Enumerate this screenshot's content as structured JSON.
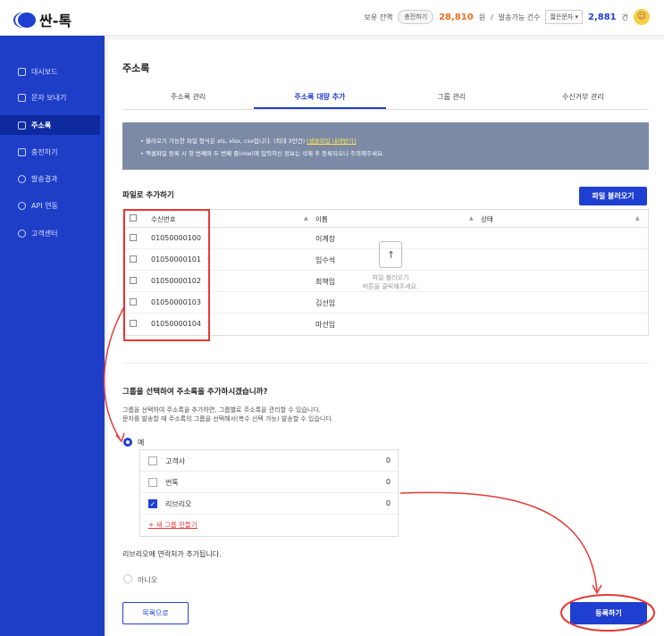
{
  "header": {
    "logo": "싼-톡",
    "balance_label": "보유 잔액",
    "charge_button": "충전하기",
    "balance_amount": "28,810",
    "balance_unit": "원",
    "sep": "/",
    "sendable_label": "발송가능 건수",
    "msg_type": "짧은문자",
    "sendable_count": "2,881",
    "sendable_unit": "건"
  },
  "sidebar": {
    "items": [
      {
        "label": "대시보드",
        "icon": "dashboard-icon"
      },
      {
        "label": "문자 보내기",
        "icon": "chat-icon"
      },
      {
        "label": "주소록",
        "icon": "people-icon"
      },
      {
        "label": "충전하기",
        "icon": "card-icon"
      },
      {
        "label": "발송결과",
        "icon": "target-icon"
      },
      {
        "label": "API 연동",
        "icon": "api-icon"
      },
      {
        "label": "고객센터",
        "icon": "help-icon"
      }
    ]
  },
  "page": {
    "title": "주소록"
  },
  "tabs": [
    {
      "label": "주소록 관리"
    },
    {
      "label": "주소록 대량 추가"
    },
    {
      "label": "그룹 관리"
    },
    {
      "label": "수신거부 관리"
    }
  ],
  "notice": {
    "line1": "불러오기 가능한 파일 형식은 xls, xlsx, csv입니다. (최대 3만건)",
    "line1_link": "[샘플파일 내려받기]",
    "line2": "엑셀파일 등록 시 첫 번째와 두 번째 줄(row)에 입력하신 정보는 삭제 후 등록되오니 주의해주세요."
  },
  "file_section": {
    "title": "파일로 추가하기",
    "load_button": "파일 불러오기"
  },
  "table": {
    "headers": [
      "수신번호",
      "이름",
      "상태"
    ],
    "rows": [
      {
        "number": "01050000100",
        "name": "이계장"
      },
      {
        "number": "01050000101",
        "name": "임수석"
      },
      {
        "number": "01050000102",
        "name": "최책임"
      },
      {
        "number": "01050000103",
        "name": "김선임"
      },
      {
        "number": "01050000104",
        "name": "마선임"
      }
    ],
    "upload_line1": "파일 불러오기",
    "upload_line2": "버튼을 클릭해주세요."
  },
  "group_section": {
    "title": "그룹을 선택하여 주소록을 추가하시겠습니까?",
    "desc1": "그룹을 선택하여 주소록을 추가하면, 그룹별로 주소록을 관리할 수 있습니다.",
    "desc2": "문자를 발송할 때 주소록의 그룹을 선택해서(복수 선택 가능) 발송할 수 있습니다.",
    "yes": "예",
    "no": "아니오",
    "groups": [
      {
        "label": "고객사",
        "count": "0",
        "checked": false
      },
      {
        "label": "썬톡",
        "count": "0",
        "checked": false
      },
      {
        "label": "리브리오",
        "count": "0",
        "checked": true
      }
    ],
    "new_group": "+ 새 그룹 만들기",
    "result": "리브리오에 연락처가 추가됩니다."
  },
  "buttons": {
    "back": "목록으로",
    "register": "등록하기"
  },
  "colors": {
    "brand": "#1f3fd1",
    "accent": "#ef6c1a",
    "annotation": "#e53935"
  }
}
